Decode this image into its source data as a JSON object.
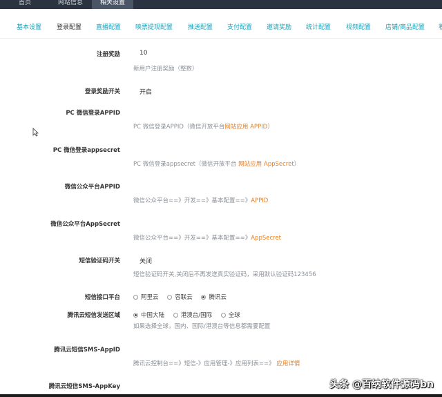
{
  "topbar": {
    "tabs": [
      {
        "label": "首页"
      },
      {
        "label": "网站信息"
      },
      {
        "label": "相关设置"
      }
    ]
  },
  "subnav": {
    "tabs": [
      {
        "label": "基本设置"
      },
      {
        "label": "登录配置"
      },
      {
        "label": "直播配置"
      },
      {
        "label": "映票提现配置"
      },
      {
        "label": "推送配置"
      },
      {
        "label": "支付配置"
      },
      {
        "label": "邀请奖励"
      },
      {
        "label": "统计配置"
      },
      {
        "label": "视频配置"
      },
      {
        "label": "店铺/商品配置"
      },
      {
        "label": "积"
      }
    ],
    "active_index": 1
  },
  "form": {
    "reg_reward": {
      "label": "注册奖励",
      "value": "10",
      "hint": "新用户注册奖励（整数）"
    },
    "login_reward_switch": {
      "label": "登录奖励开关",
      "value": "开启"
    },
    "pc_wechat_appid": {
      "label": "PC 微信登录APPID",
      "hint_prefix": "PC 微信登录APPID（微信开放平台",
      "hint_em": "网站应用 APPID",
      "hint_suffix": "）"
    },
    "pc_wechat_appsecret": {
      "label": "PC 微信登录appsecret",
      "hint_prefix": "PC 微信登录appsecret（微信开放平台 ",
      "hint_em": "网站应用 AppSecret",
      "hint_suffix": "）"
    },
    "mp_appid": {
      "label": "微信公众平台APPID",
      "hint_prefix": "微信公众平台==》开发==》基本配置==》",
      "hint_em": "APPID"
    },
    "mp_appsecret": {
      "label": "微信公众平台AppSecret",
      "hint_prefix": "微信公众平台==》开发==》基本配置==》",
      "hint_em": "AppSecret"
    },
    "sms_code_switch": {
      "label": "短信验证码开关",
      "value": "关闭",
      "hint": "短信验证码开关,关闭后不再发送真实验证码，采用默认验证码123456"
    },
    "sms_platform": {
      "label": "短信接口平台",
      "options": [
        {
          "label": "阿里云",
          "checked": false
        },
        {
          "label": "容联云",
          "checked": false
        },
        {
          "label": "腾讯云",
          "checked": true
        }
      ]
    },
    "tencent_sms_region": {
      "label": "腾讯云短信发送区域",
      "options": [
        {
          "label": "中国大陆",
          "checked": true
        },
        {
          "label": "港澳台/国际",
          "checked": false
        },
        {
          "label": "全球",
          "checked": false
        }
      ],
      "hint": "如果选择全球，国内、国际/港澳台等信息都需要配置"
    },
    "tencent_sms_appid": {
      "label": "腾讯云短信SMS-AppID",
      "hint_prefix": "腾讯云控制台==》短信-》应用管理-》应用列表==》 ",
      "hint_em": "应用详情"
    },
    "tencent_sms_appkey": {
      "label": "腾讯云短信SMS-AppKey"
    }
  },
  "watermark": "头条 @百纳软件源码bn",
  "colors": {
    "topbar": "#2b3340",
    "tab_link": "#17a2b8",
    "hint_em": "#e67e22",
    "hint": "#8a8f96"
  }
}
